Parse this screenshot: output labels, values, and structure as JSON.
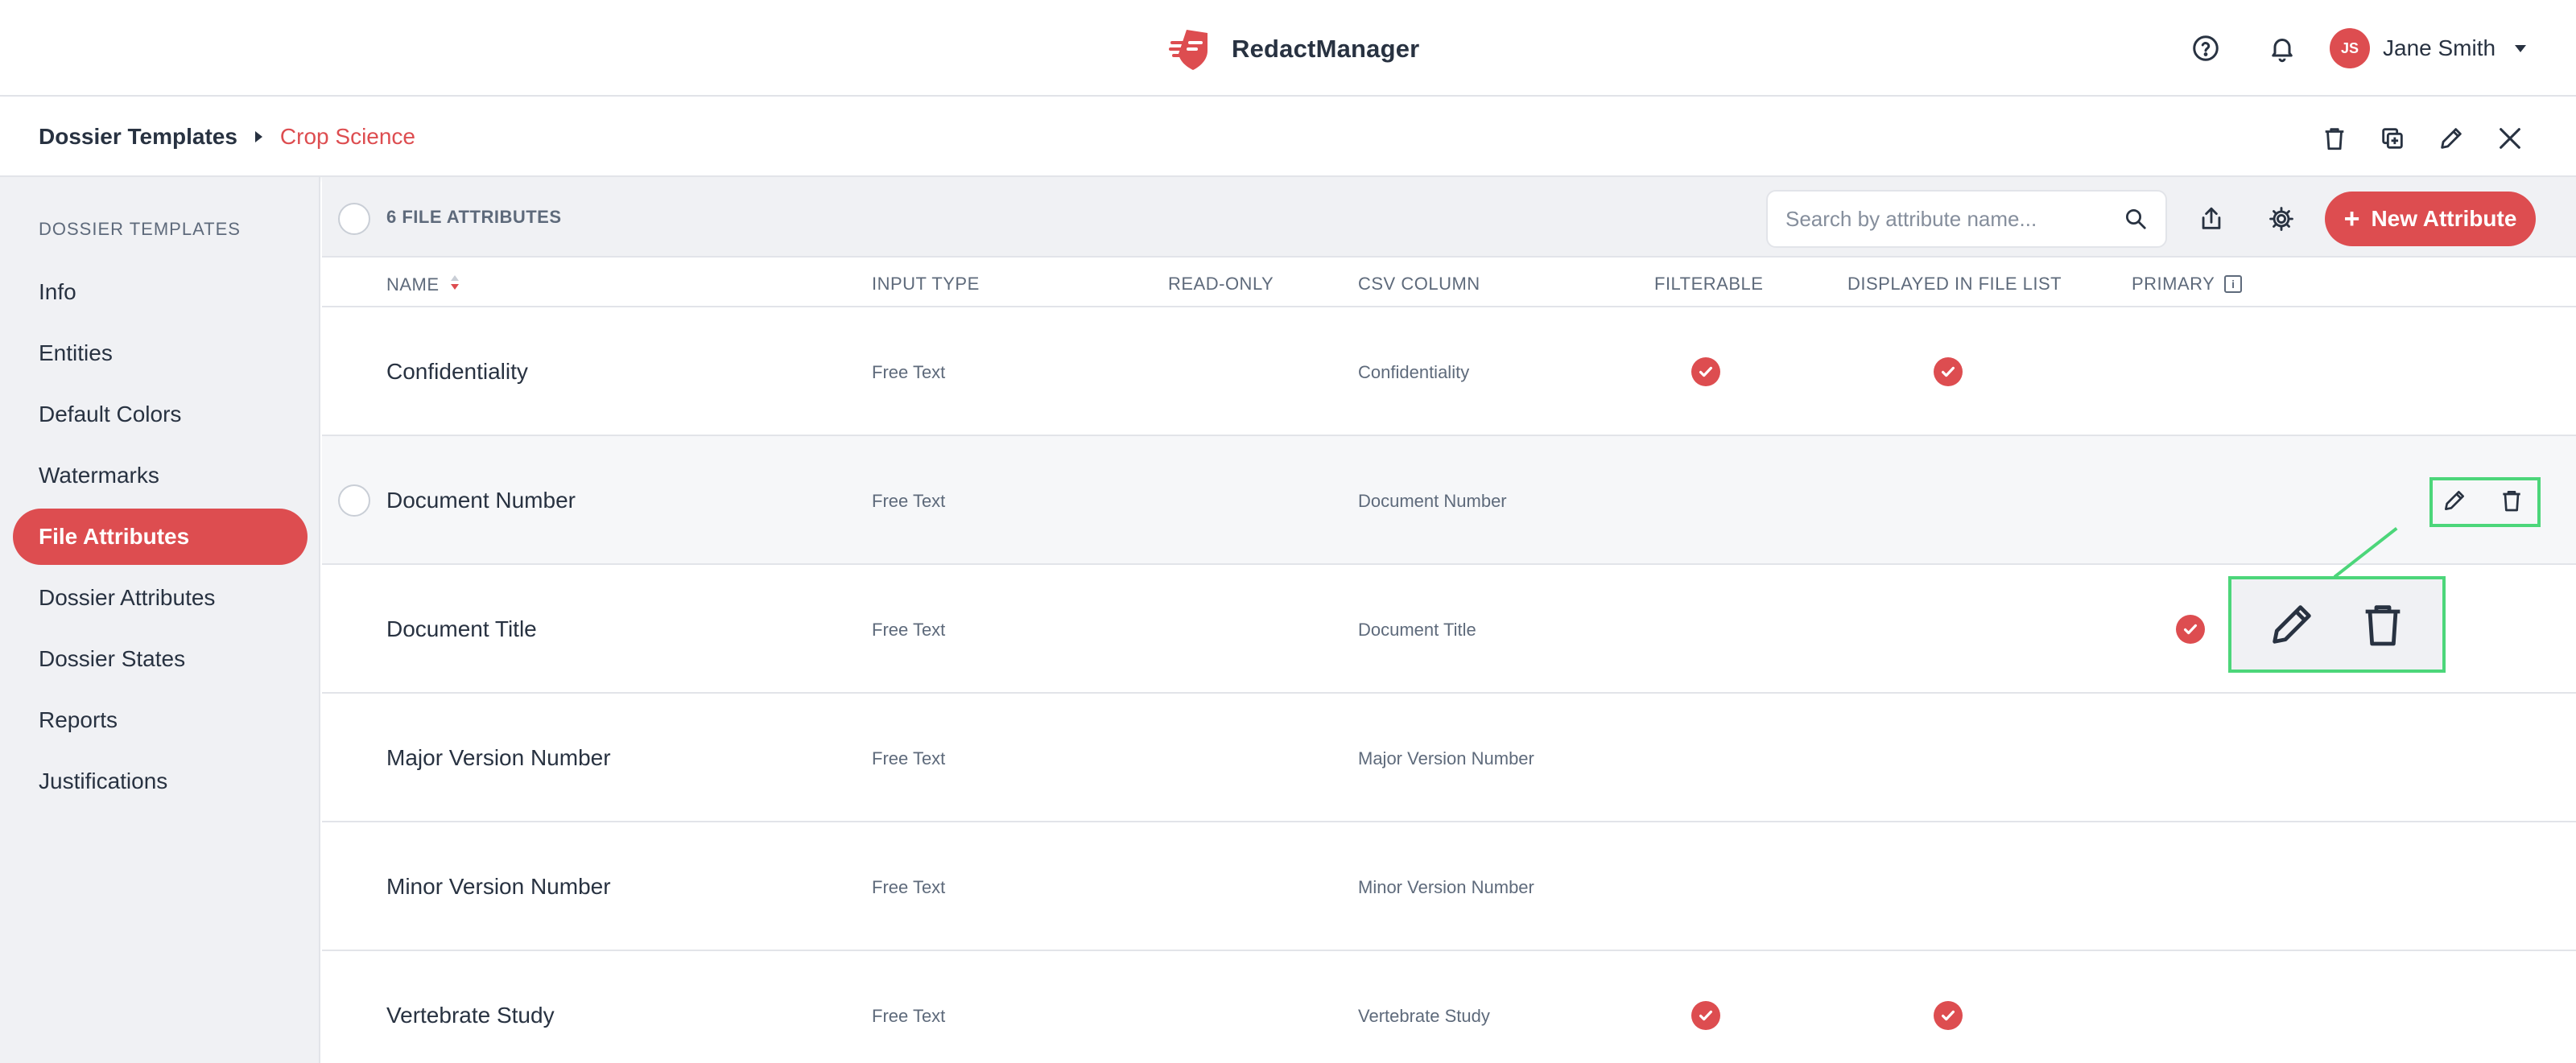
{
  "app": {
    "name": "RedactManager",
    "help_icon": "help-circle-icon",
    "notifications_icon": "bell-icon",
    "user": {
      "initials": "JS",
      "name": "Jane Smith"
    }
  },
  "breadcrumb": {
    "root": "Dossier Templates",
    "current": "Crop Science",
    "actions": [
      "trash-icon",
      "duplicate-icon",
      "pencil-icon",
      "close-icon"
    ]
  },
  "sidebar": {
    "title": "DOSSIER TEMPLATES",
    "items": [
      {
        "label": "Info",
        "active": false
      },
      {
        "label": "Entities",
        "active": false
      },
      {
        "label": "Default Colors",
        "active": false
      },
      {
        "label": "Watermarks",
        "active": false
      },
      {
        "label": "File Attributes",
        "active": true
      },
      {
        "label": "Dossier Attributes",
        "active": false
      },
      {
        "label": "Dossier States",
        "active": false
      },
      {
        "label": "Reports",
        "active": false
      },
      {
        "label": "Justifications",
        "active": false
      }
    ]
  },
  "toolbar": {
    "count_label": "6 FILE ATTRIBUTES",
    "search_placeholder": "Search by attribute name...",
    "new_button": "New Attribute"
  },
  "table": {
    "columns": {
      "name": "NAME",
      "input_type": "INPUT TYPE",
      "read_only": "READ-ONLY",
      "csv_column": "CSV COLUMN",
      "filterable": "FILTERABLE",
      "displayed": "DISPLAYED IN FILE LIST",
      "primary": "PRIMARY"
    },
    "rows": [
      {
        "name": "Confidentiality",
        "input_type": "Free Text",
        "csv_column": "Confidentiality",
        "filterable": true,
        "displayed": true,
        "primary": false
      },
      {
        "name": "Document Number",
        "input_type": "Free Text",
        "csv_column": "Document Number",
        "filterable": false,
        "displayed": false,
        "primary": false
      },
      {
        "name": "Document Title",
        "input_type": "Free Text",
        "csv_column": "Document Title",
        "filterable": false,
        "displayed": false,
        "primary": true
      },
      {
        "name": "Major Version Number",
        "input_type": "Free Text",
        "csv_column": "Major Version Number",
        "filterable": false,
        "displayed": false,
        "primary": false
      },
      {
        "name": "Minor Version Number",
        "input_type": "Free Text",
        "csv_column": "Minor Version Number",
        "filterable": false,
        "displayed": false,
        "primary": false
      },
      {
        "name": "Vertebrate Study",
        "input_type": "Free Text",
        "csv_column": "Vertebrate Study",
        "filterable": true,
        "displayed": true,
        "primary": false
      }
    ]
  },
  "colors": {
    "accent": "#dd4d50",
    "text": "#283241",
    "muted": "#5e6a7b",
    "sidebar_bg": "#f0f1f4",
    "highlight": "#4cd67a"
  }
}
